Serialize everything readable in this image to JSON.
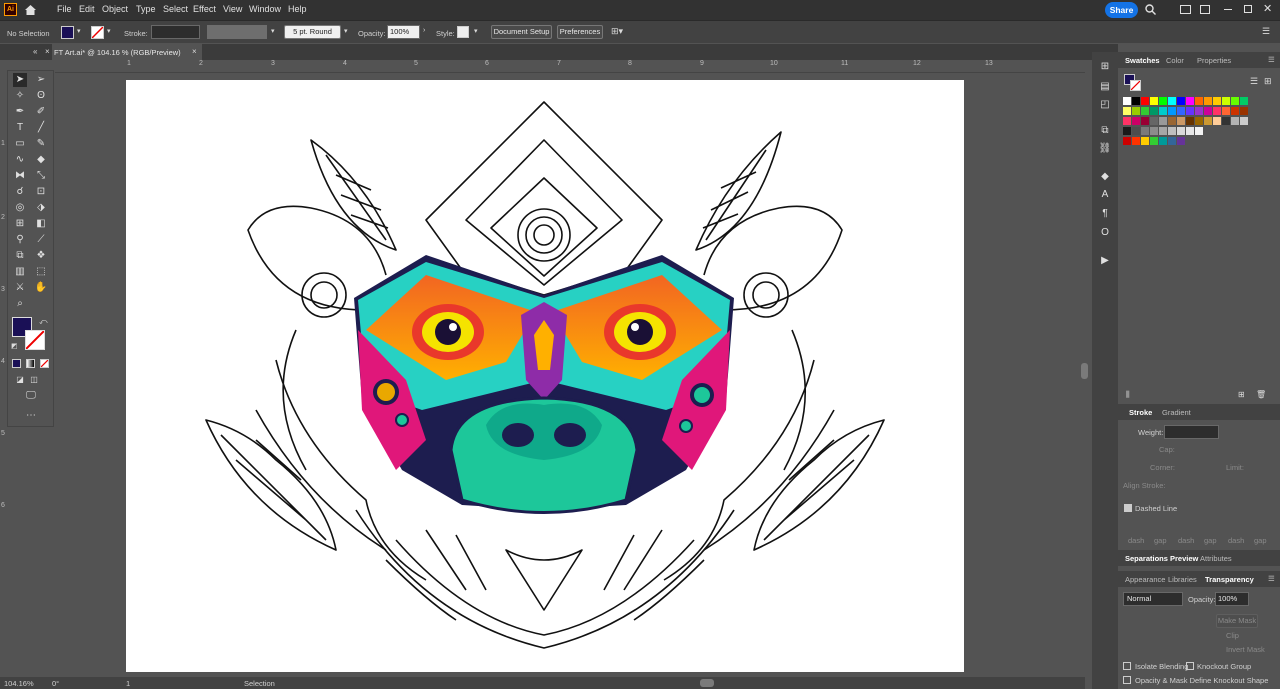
{
  "app": {
    "logo": "Ai"
  },
  "menubar": {
    "items": [
      "File",
      "Edit",
      "Object",
      "Type",
      "Select",
      "Effect",
      "View",
      "Window",
      "Help"
    ],
    "share_label": "Share"
  },
  "control": {
    "selection": "No Selection",
    "stroke_label": "Stroke:",
    "brush": "5 pt. Round",
    "opacity_label": "Opacity:",
    "opacity_value": "100%",
    "style_label": "Style:",
    "document_setup": "Document Setup",
    "preferences": "Preferences"
  },
  "tab": {
    "title": "FT Art.ai* @ 104.16 % (RGB/Preview)"
  },
  "ruler": {
    "ticks": [
      "1",
      "2",
      "3",
      "4",
      "5",
      "6",
      "7",
      "8",
      "9",
      "10",
      "11",
      "12",
      "13"
    ],
    "left_ticks": [
      "1",
      "2",
      "3",
      "4",
      "5",
      "6"
    ]
  },
  "colors": {
    "fill": "#1a1056",
    "accent": "#1473e6"
  },
  "panels": {
    "swatches_tabs": [
      "Swatches",
      "Color",
      "Properties"
    ],
    "stroke_tabs": [
      "Stroke",
      "Gradient"
    ],
    "weight_label": "Weight:",
    "caps_label": "Cap:",
    "corner_label": "Corner:",
    "limit_label": "Limit:",
    "align_label": "Align Stroke:",
    "dashed_line": "Dashed Line",
    "dash_labels": [
      "dash",
      "gap",
      "dash",
      "gap",
      "dash",
      "gap"
    ],
    "sep_tabs": [
      "Separations Preview",
      "Attributes"
    ],
    "trans_tabs": [
      "Appearance",
      "Libraries",
      "Transparency"
    ],
    "blend_mode": "Normal",
    "opacity_label": "Opacity:",
    "opacity_value": "100%",
    "make_mask": "Make Mask",
    "clip": "Clip",
    "invert_mask": "Invert Mask",
    "isolate": "Isolate Blending",
    "knockout": "Knockout Group",
    "opacity_mask": "Opacity & Mask Define Knockout Shape"
  },
  "status": {
    "zoom": "104.16%",
    "rotate": "0°",
    "artboard": "1",
    "tool": "Selection"
  },
  "swatch_rows": [
    [
      "#ffffff",
      "#000000",
      "#ff0000",
      "#ffff00",
      "#00ff00",
      "#00ffff",
      "#0000ff",
      "#ff00ff",
      "#ff6600",
      "#ff9900",
      "#ffcc00",
      "#ccff00",
      "#66ff00",
      "#00cc66"
    ],
    [
      "#ffff66",
      "#99cc00",
      "#33cc33",
      "#009966",
      "#00cccc",
      "#0099ff",
      "#3366ff",
      "#6633ff",
      "#9933cc",
      "#cc0099",
      "#ff3366",
      "#ff6633",
      "#cc3300",
      "#993300"
    ],
    [
      "#ff3366",
      "#cc0066",
      "#990033",
      "#666666",
      "#999999",
      "#996633",
      "#cc9966",
      "#663300",
      "#996600",
      "#cc9933",
      "#ffcc99",
      "#333333",
      "#b3b3b3",
      "#cccccc"
    ],
    [
      "#1a1a1a",
      "#4d4d4d",
      "#7a7a7a",
      "#8c8c8c",
      "#a6a6a6",
      "#bfbfbf",
      "#d9d9d9",
      "#e6e6e6",
      "#f2f2f2"
    ],
    [
      "#cc0000",
      "#ff3300",
      "#ffcc00",
      "#33cc33",
      "#009999",
      "#336699",
      "#663399"
    ]
  ]
}
